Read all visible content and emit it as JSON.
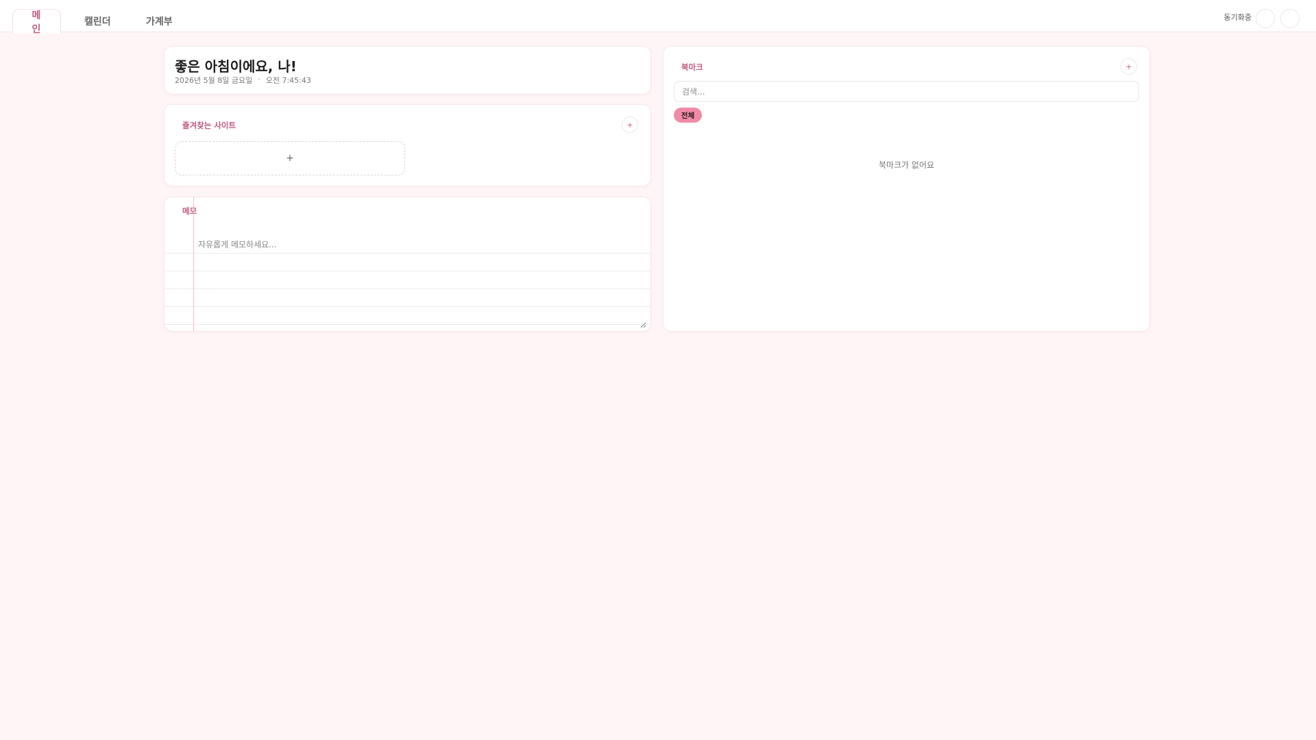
{
  "nav": {
    "tabs": [
      {
        "label": "메인",
        "icon": "home-icon",
        "active": true
      },
      {
        "label": "캘린더",
        "icon": "calendar-icon",
        "active": false
      },
      {
        "label": "가계부",
        "icon": "wallet-icon",
        "active": false
      }
    ],
    "sync_status": "동기화중",
    "sync_icon": "sync-icon",
    "right_buttons": [
      "theme-icon",
      "settings-icon"
    ]
  },
  "greeting": {
    "title": "좋은 아침이에요, 나!",
    "date": "2026년 5월 8일 금요일",
    "separator": "·",
    "time": "오전 7:45:43"
  },
  "favorites": {
    "header": "즐겨찾는 사이트",
    "header_icon": "star-icon",
    "add_button": "+",
    "add_tile": "+"
  },
  "memo": {
    "header": "메모",
    "header_icon": "note-icon",
    "placeholder": "자유롭게 메모하세요..."
  },
  "bookmarks": {
    "header": "북마크",
    "header_icon": "bookmark-icon",
    "add_button": "+",
    "search_placeholder": "검색...",
    "filter_chip": "전체",
    "empty_icon": "bookmark-empty-icon",
    "empty_text": "북마크가 없어요"
  },
  "colors": {
    "background": "#fff5f6",
    "accent": "#c05c7e",
    "chip": "#f18aa7",
    "memo_margin": "#f4b9c9"
  }
}
